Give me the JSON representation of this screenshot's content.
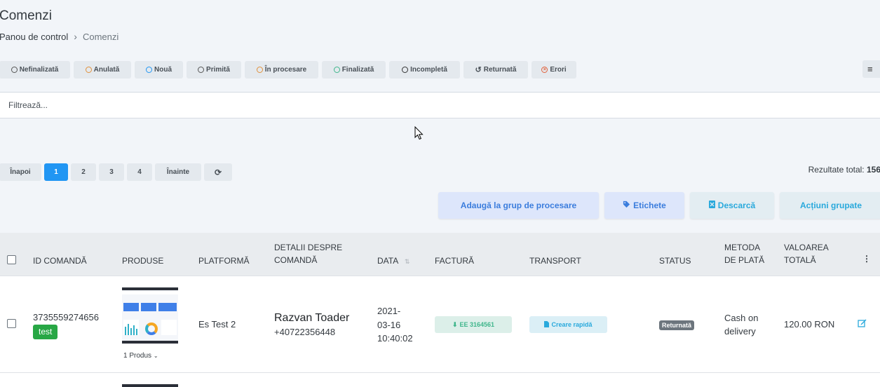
{
  "page": {
    "title": "Comenzi"
  },
  "breadcrumb": {
    "root": "Panou de control",
    "current": "Comenzi"
  },
  "status_filters": [
    {
      "label": "Nefinalizată",
      "ring": "#555555"
    },
    {
      "label": "Anulată",
      "ring": "#e0913b"
    },
    {
      "label": "Nouă",
      "ring": "#2196f3"
    },
    {
      "label": "Primită",
      "ring": "#555555"
    },
    {
      "label": "În procesare",
      "ring": "#e0913b"
    },
    {
      "label": "Finalizată",
      "ring": "#3fb68b"
    },
    {
      "label": "Incompletă",
      "ring": "#333333"
    },
    {
      "label": "Returnată",
      "icon": "undo-icon"
    },
    {
      "label": "Erori",
      "icon": "times-circle-icon",
      "color": "#e0613b"
    }
  ],
  "filter": {
    "placeholder": "Filtrează..."
  },
  "pagination": {
    "prev": "Înapoi",
    "pages": [
      "1",
      "2",
      "3",
      "4"
    ],
    "active": "1",
    "next": "Înainte"
  },
  "results": {
    "label": "Rezultate total:",
    "count": "156"
  },
  "actions": {
    "add_group": "Adaugă la grup de procesare",
    "labels": "Etichete",
    "download": "Descarcă",
    "group_actions": "Acțiuni grupate"
  },
  "table": {
    "headers": {
      "order_id": "ID COMANDĂ",
      "products": "PRODUSE",
      "platform": "PLATFORMĂ",
      "details": "DETALII DESPRE COMANDĂ",
      "date": "DATA",
      "invoice": "FACTURĂ",
      "transport": "TRANSPORT",
      "status": "STATUS",
      "payment": "METODA DE PLATĂ",
      "total": "VALOAREA TOTALĂ"
    },
    "rows": [
      {
        "order_id": "3735559274656",
        "tag": "test",
        "products": "1 Produs",
        "platform": "Es Test 2",
        "customer": "Razvan Toader",
        "phone": "+40722356448",
        "date_l1": "2021-",
        "date_l2": "03-16",
        "date_l3": "10:40:02",
        "invoice": "EE 3164561",
        "transport": "Creare rapidă",
        "status": "Returnată",
        "payment_l1": "Cash on",
        "payment_l2": "delivery",
        "total": "120.00 RON"
      }
    ]
  },
  "colors": {
    "accent": "#2196f3",
    "action_blue_text": "#3b7ddd",
    "teal": "#3fb68b"
  }
}
